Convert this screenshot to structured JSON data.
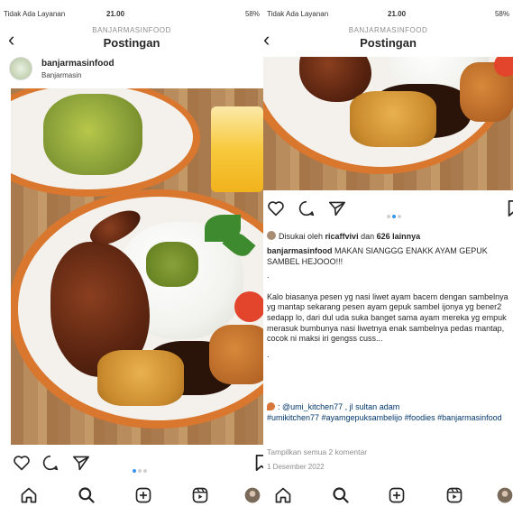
{
  "left": {
    "status": {
      "carrier": "Tidak Ada Layanan",
      "time": "21.00",
      "battery": "58%"
    },
    "header": {
      "username": "BANJARMASINFOOD",
      "title": "Postingan"
    },
    "author": {
      "name": "banjarmasinfood",
      "location": "Banjarmasin"
    },
    "carousel": {
      "count": 3,
      "active": 1
    }
  },
  "right": {
    "status": {
      "carrier": "Tidak Ada Layanan",
      "time": "21.00",
      "battery": "58%"
    },
    "header": {
      "username": "BANJARMASINFOOD",
      "title": "Postingan"
    },
    "carousel": {
      "count": 3,
      "active": 1
    },
    "likes": {
      "prefix": "Disukai oleh",
      "user": "ricaffvivi",
      "conj": "dan",
      "others": "626 lainnya"
    },
    "caption": {
      "username": "banjarmasinfood",
      "headline": "MAKAN SIANGGG ENAKK AYAM GEPUK SAMBEL HEJOOO!!!",
      "dot1": ".",
      "body": "Kalo biasanya pesen yg nasi liwet ayam bacem dengan sambelnya yg mantap sekarang pesen ayam gepuk sambel ijonya yg bener2 sedapp lo, dari dul uda suka banget sama ayam mereka yg empuk merasuk bumbunya nasi liwetnya enak sambelnya pedas mantap, cocok ni maksi iri gengss cuss...",
      "dot2": ".",
      "location_line": ": @umi_kitchen77 , jl sultan adam",
      "hashtags": "#umikitchen77 #ayamgepuksambelijo #foodies #banjarmasinfood"
    },
    "comments_link": "Tampilkan semua 2 komentar",
    "date": "1 Desember 2022"
  },
  "icons": {
    "back": "chevron-left-icon",
    "like": "heart-icon",
    "comment": "comment-icon",
    "share": "send-icon",
    "save": "bookmark-icon",
    "home": "home-icon",
    "search": "search-icon",
    "add": "add-post-icon",
    "reels": "reels-icon",
    "profile": "profile-avatar-icon"
  },
  "colors": {
    "accent": "#3897f0",
    "text": "#262626",
    "muted": "#8e8e8e",
    "link": "#00376b"
  }
}
